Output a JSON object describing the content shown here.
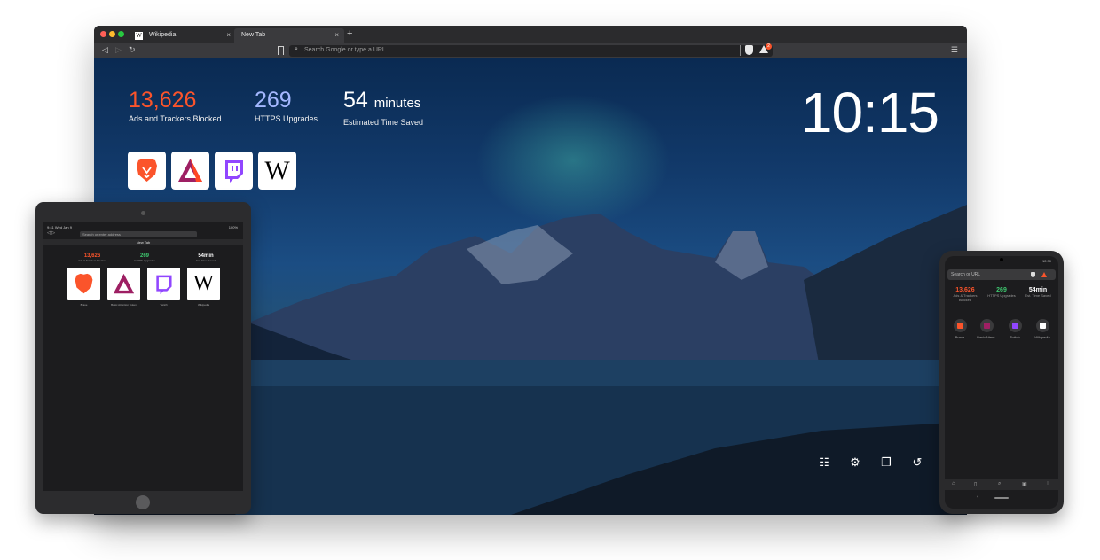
{
  "desktop": {
    "tabs": [
      {
        "label": "Wikipedia",
        "favicon": "W",
        "close": "×"
      },
      {
        "label": "New Tab",
        "close": "×"
      }
    ],
    "new_tab": "+",
    "address_placeholder": "Search Google or type a URL",
    "rewards_badge_count": "2",
    "stats": {
      "ads_blocked": "13,626",
      "ads_blocked_label": "Ads and Trackers Blocked",
      "https_upgrades": "269",
      "https_upgrades_label": "HTTPS Upgrades",
      "time_saved": "54",
      "time_saved_unit": "minutes",
      "time_saved_label": "Estimated Time Saved"
    },
    "clock": "10:15",
    "top_sites": [
      {
        "icon": "brave-lion-icon"
      },
      {
        "icon": "bat-triangle-icon"
      },
      {
        "icon": "twitch-icon"
      },
      {
        "icon": "wikipedia-icon",
        "glyph": "W"
      }
    ],
    "bottom_controls": [
      "customize-icon",
      "settings-icon",
      "bookmarks-icon",
      "history-icon"
    ],
    "colors": {
      "brave_orange": "#fb542b",
      "https_blue": "#a4b8ff"
    }
  },
  "tablet": {
    "status_time": "9:41 Wed Jan 9",
    "battery": "100%",
    "address_placeholder": "Search or enter address",
    "tab_title": "New Tab",
    "stats": [
      {
        "value": "13,626",
        "label": "Ads & Trackers Blocked",
        "color": "#fb542b"
      },
      {
        "value": "269",
        "label": "HTTPS Upgrades",
        "color": "#3ec76f"
      },
      {
        "value": "54min",
        "label": "Est. Time Saved",
        "color": "#ffffff"
      }
    ],
    "top_sites": [
      {
        "label": "Brave"
      },
      {
        "label": "Basic Attention Token"
      },
      {
        "label": "Twitch"
      },
      {
        "label": "Wikipedia",
        "glyph": "W"
      }
    ]
  },
  "phone": {
    "status": "12:30",
    "address_placeholder": "Search or URL",
    "stats": [
      {
        "value": "13,626",
        "label": "Ads & Trackers Blocked",
        "color": "#fb542b"
      },
      {
        "value": "269",
        "label": "HTTPS Upgrades",
        "color": "#3ec76f"
      },
      {
        "value": "54min",
        "label": "Est. Time Saved",
        "color": "#ffffff"
      }
    ],
    "top_sites": [
      {
        "label": "Brave",
        "color": "#fb542b"
      },
      {
        "label": "BasicAttent...",
        "color": "#9e1f63"
      },
      {
        "label": "Twitch",
        "color": "#9146ff"
      },
      {
        "label": "Wikipedia",
        "color": "#ffffff"
      }
    ]
  }
}
